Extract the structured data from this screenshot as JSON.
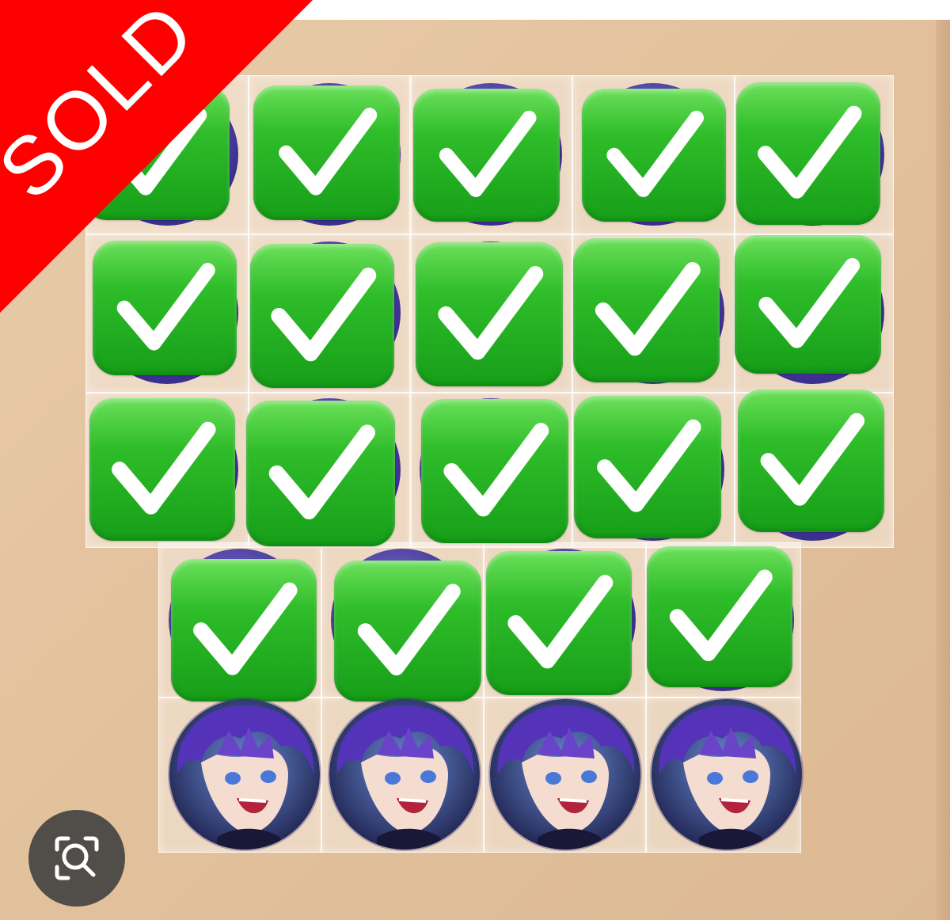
{
  "banner": {
    "text": "SOLD",
    "color": "#ff0000",
    "text_color": "#ffffff"
  },
  "checkmark_icon": "heavy-check-mark-icon",
  "colors": {
    "check_green": "#1fae1f",
    "background_wood": "#e3c29e",
    "badge_purple": "#4b3bb0"
  },
  "items": {
    "sold_count": 19,
    "available_count": 4
  },
  "lens_button": {
    "icon": "image-search-icon"
  }
}
